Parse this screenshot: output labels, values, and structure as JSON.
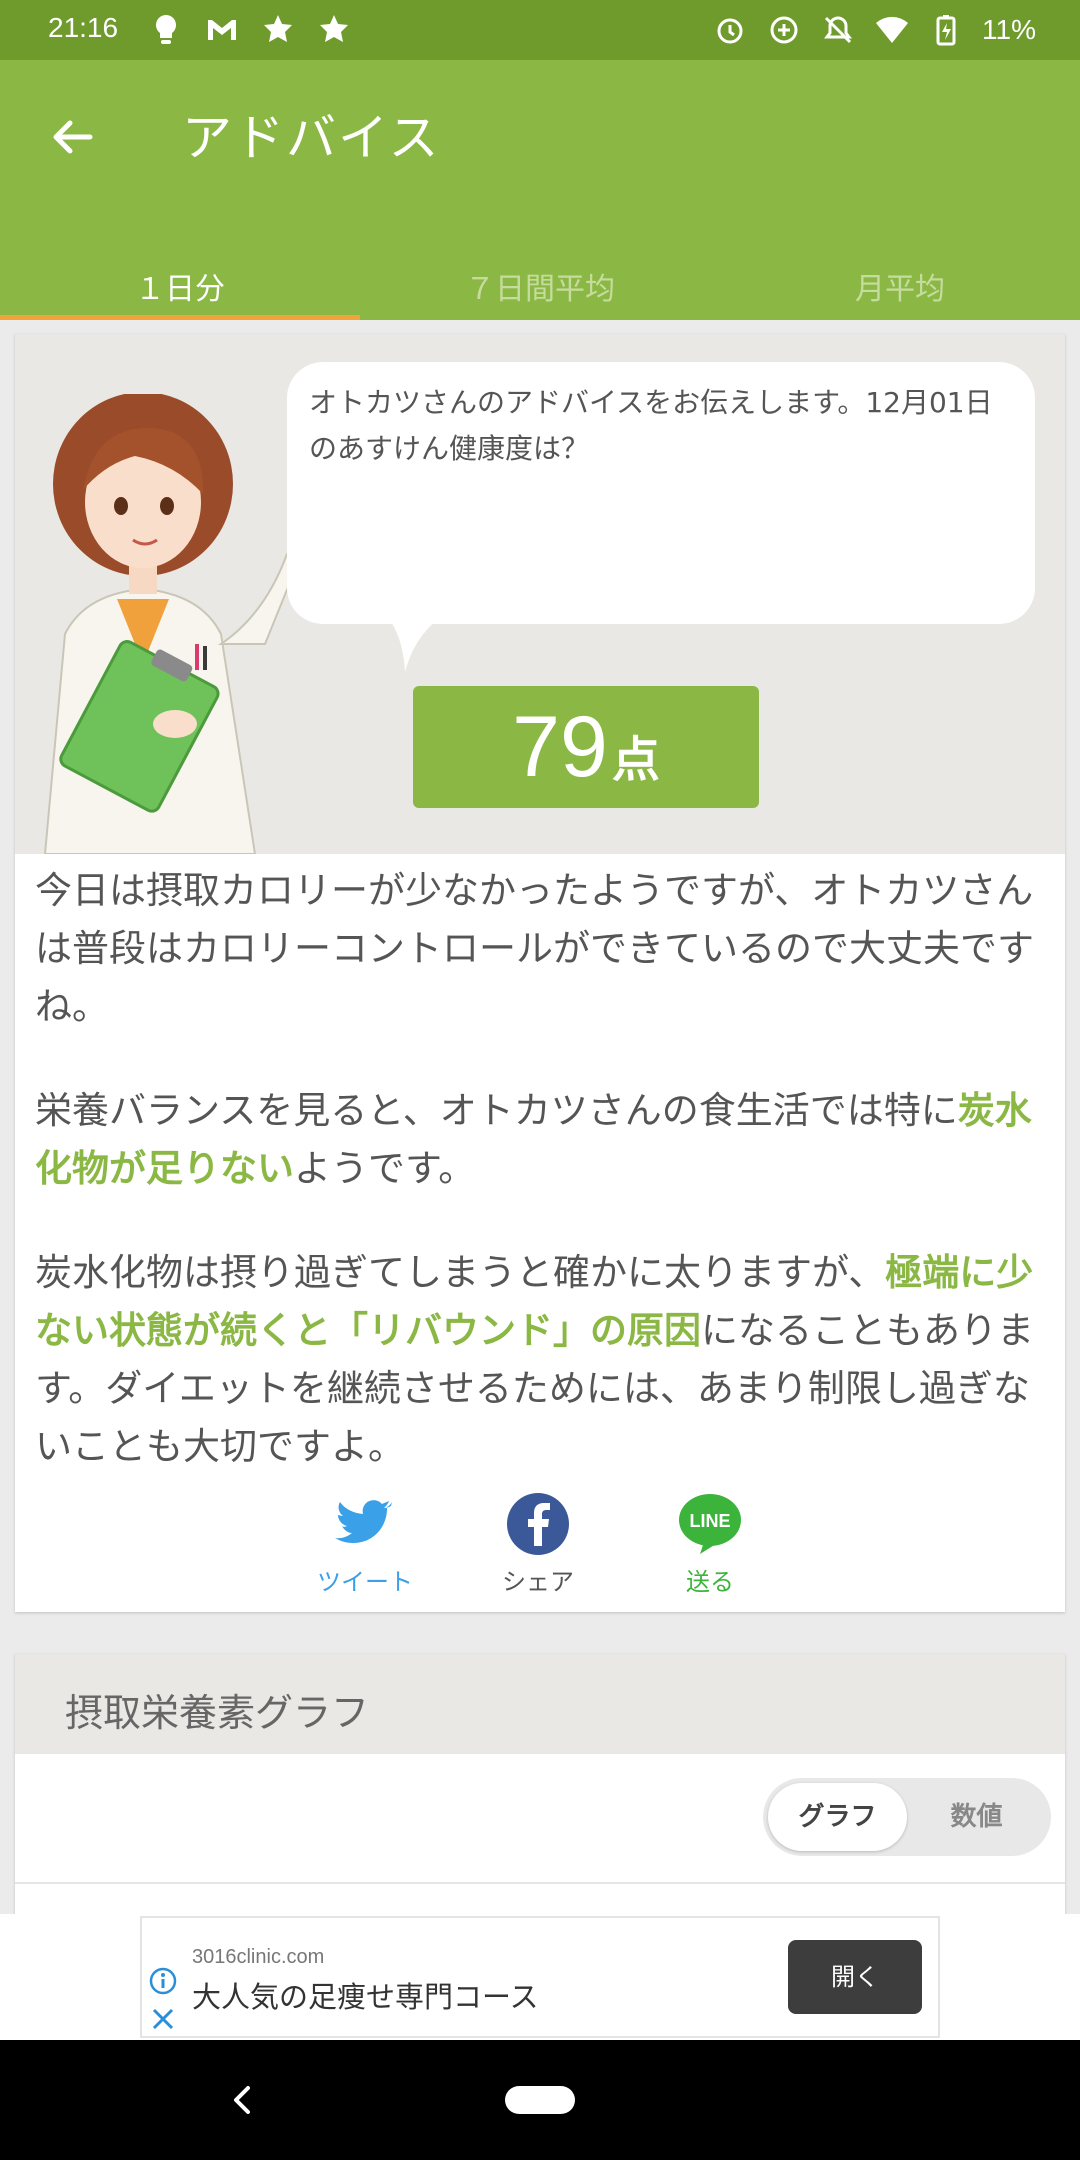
{
  "status_bar": {
    "time": "21:16",
    "battery": "11%",
    "icons_left": [
      "lightbulb-icon",
      "gmail-icon",
      "star-badge-icon",
      "star-badge-icon"
    ],
    "icons_right": [
      "alarm-icon",
      "data-saver-icon",
      "notifications-off-icon",
      "wifi-icon",
      "battery-charging-icon"
    ]
  },
  "app_bar": {
    "title": "アドバイス",
    "back_icon": "arrow-back-icon"
  },
  "tabs": [
    {
      "label": "１日分",
      "active": true
    },
    {
      "label": "７日間平均",
      "active": false
    },
    {
      "label": "月平均",
      "active": false
    }
  ],
  "advice": {
    "bubble_text": "オトカツさんのアドバイスをお伝えします。12月01日のあすけん健康度は？",
    "score": "79",
    "score_unit": "点",
    "para1": "今日は摂取カロリーが少なかったようですが、オトカツさんは普段はカロリーコントロールができているので大丈夫ですね。",
    "para2_pre": "栄養バランスを見ると、オトカツさんの食生活では特に",
    "para2_hl": "炭水化物が足りない",
    "para2_post": "ようです。",
    "para3_pre": "炭水化物は摂り過ぎてしまうと確かに太りますが、",
    "para3_hl": "極端に少ない状態が続くと「リバウンド」の原因",
    "para3_post": "になることもあります。ダイエットを継続させるためには、あまり制限し過ぎないことも大切ですよ。"
  },
  "share": {
    "tweet": "ツイート",
    "share": "シェア",
    "line": "送る",
    "line_logo": "LINE"
  },
  "nutrients": {
    "title": "摂取栄養素グラフ",
    "toggle_graph": "グラフ",
    "toggle_values": "数値"
  },
  "ad": {
    "domain": "3016clinic.com",
    "title": "大人気の足痩せ専門コース",
    "open_label": "開く"
  },
  "colors": {
    "status_bar": "#6f9a2c",
    "primary": "#8bb844",
    "tab_indicator": "#f2a33a"
  }
}
